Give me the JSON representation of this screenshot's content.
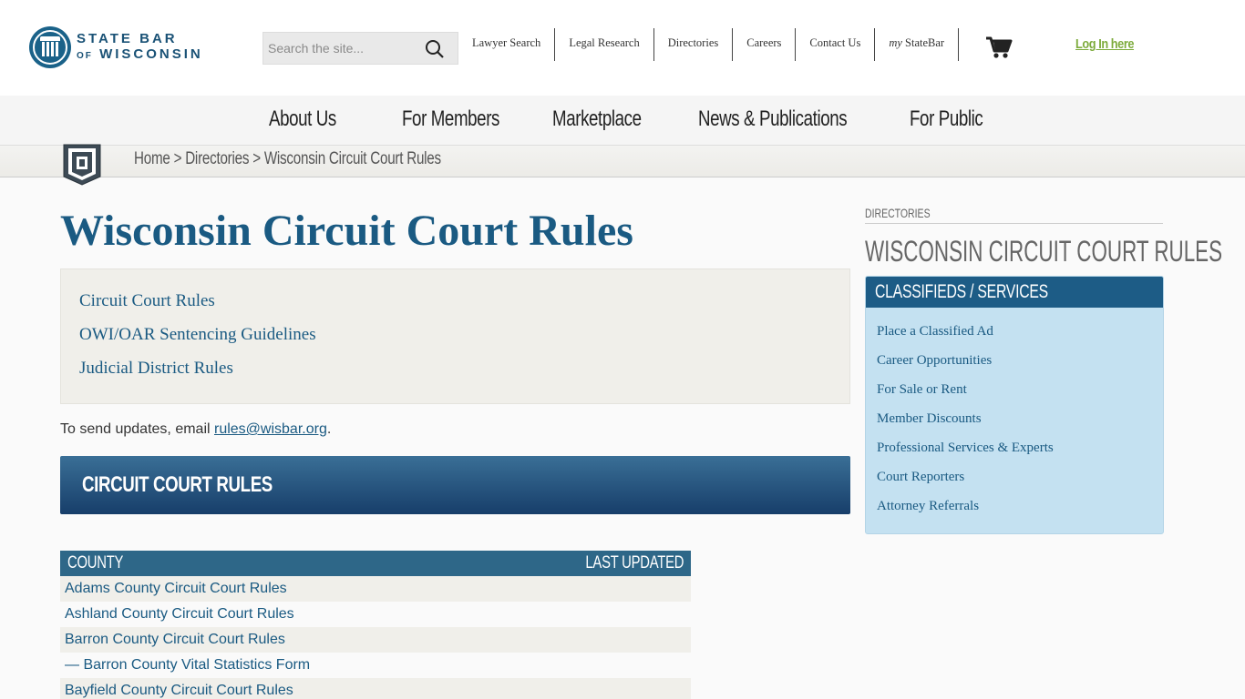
{
  "header": {
    "logo_line1": "STATE BAR",
    "logo_of": "OF",
    "logo_line2": "WISCONSIN",
    "search_placeholder": "Search the site...",
    "utility_links": [
      "Lawyer Search",
      "Legal Research",
      "Directories",
      "Careers",
      "Contact Us"
    ],
    "my_statebar_prefix": "my",
    "my_statebar_label": "StateBar",
    "login_label": "Log In here"
  },
  "main_nav": [
    "About Us",
    "For Members",
    "Marketplace",
    "News & Publications",
    "For Public"
  ],
  "breadcrumb": {
    "home": "Home",
    "sep": ">",
    "directories": "Directories",
    "current": "Wisconsin Circuit Court Rules"
  },
  "content": {
    "title": "Wisconsin Circuit Court Rules",
    "jump_links": [
      "Circuit Court Rules",
      "OWI/OAR Sentencing Guidelines",
      "Judicial District Rules"
    ],
    "update_prefix": "To send updates, email ",
    "update_email": "rules@wisbar.org",
    "update_suffix": ".",
    "section_heading": "CIRCUIT COURT RULES",
    "table": {
      "col_county": "COUNTY",
      "col_updated": "LAST UPDATED",
      "rows": [
        "Adams County Circuit Court Rules",
        "Ashland County Circuit Court Rules",
        "Barron County Circuit Court Rules",
        "— Barron County Vital Statistics Form",
        "Bayfield County Circuit Court Rules"
      ]
    }
  },
  "sidebar": {
    "kicker": "DIRECTORIES",
    "title": "WISCONSIN CIRCUIT COURT RULES",
    "box_heading": "CLASSIFIEDS / SERVICES",
    "links": [
      "Place a Classified Ad",
      "Career Opportunities",
      "For Sale or Rent",
      "Member Discounts",
      "Professional Services & Experts",
      "Court Reporters",
      "Attorney Referrals"
    ]
  },
  "colors": {
    "brand_blue": "#1a5a82",
    "login_green": "#7dab3c",
    "sidebar_bg": "#c4e1f1"
  }
}
